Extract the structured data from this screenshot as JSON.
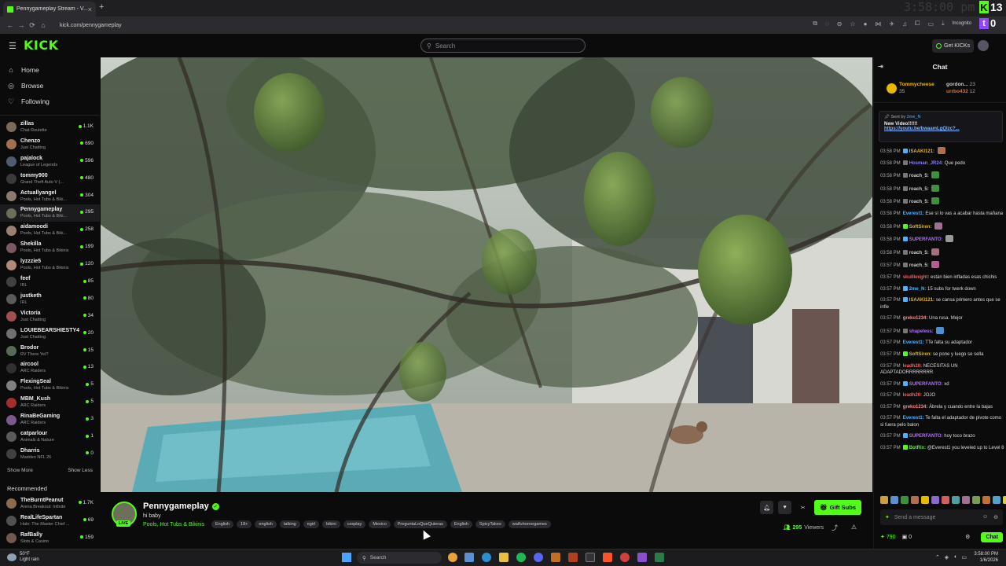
{
  "browser": {
    "tab_title": "Pennygameplay Stream - V...",
    "url": "kick.com/pennygameplay",
    "incognito_label": "Incognito",
    "overlay_time": "3:58:00 pm",
    "kick_viewers_badge": "13",
    "twitch_viewers_badge": "0"
  },
  "header": {
    "search_placeholder": "Search",
    "get_kicks_label": "Get KICKs"
  },
  "sidebar": {
    "nav": [
      {
        "label": "Home",
        "icon": "home-icon"
      },
      {
        "label": "Browse",
        "icon": "compass-icon"
      },
      {
        "label": "Following",
        "icon": "heart-icon"
      }
    ],
    "following": [
      {
        "name": "zillas",
        "category": "Chat Roulette",
        "viewers": "1.1K",
        "color": "#7a6a5a"
      },
      {
        "name": "Chenzo",
        "category": "Just Chatting",
        "viewers": "690",
        "color": "#a07050"
      },
      {
        "name": "pajalock",
        "category": "League of Legends",
        "viewers": "596",
        "color": "#505a70"
      },
      {
        "name": "tommy900",
        "category": "Grand Theft Auto V (...",
        "viewers": "480",
        "color": "#3a3a3a"
      },
      {
        "name": "Actuallyangel",
        "category": "Pools, Hot Tubs & Biki...",
        "viewers": "304",
        "color": "#8a7a70"
      },
      {
        "name": "Pennygameplay",
        "category": "Pools, Hot Tubs & Biki...",
        "viewers": "295",
        "color": "#6c6f5a"
      },
      {
        "name": "aidamoodi",
        "category": "Pools, Hot Tubs & Biki...",
        "viewers": "258",
        "color": "#9a8070"
      },
      {
        "name": "Shekilla",
        "category": "Pools, Hot Tubs & Bikinis",
        "viewers": "199",
        "color": "#7a5a60"
      },
      {
        "name": "lyzzzie5",
        "category": "Pools, Hot Tubs & Bikinis",
        "viewers": "120",
        "color": "#b08a7a"
      },
      {
        "name": "feef",
        "category": "IRL",
        "viewers": "85",
        "color": "#404040"
      },
      {
        "name": "justketh",
        "category": "IRL",
        "viewers": "80",
        "color": "#5a5a5a"
      },
      {
        "name": "Victoria",
        "category": "Just Chatting",
        "viewers": "34",
        "color": "#a05050"
      },
      {
        "name": "LOUIEBEARSHIESTY4",
        "category": "Just Chatting",
        "viewers": "20",
        "color": "#707070"
      },
      {
        "name": "Brodor",
        "category": "RV There Yet?",
        "viewers": "15",
        "color": "#5a6a5a"
      },
      {
        "name": "aircool",
        "category": "ARC Raiders",
        "viewers": "13",
        "color": "#303030"
      },
      {
        "name": "FlexingSeal",
        "category": "Pools, Hot Tubs & Bikinis",
        "viewers": "5",
        "color": "#808080"
      },
      {
        "name": "MBM_Kush",
        "category": "ARC Raiders",
        "viewers": "5",
        "color": "#a03030"
      },
      {
        "name": "RinaBeGaming",
        "category": "ARC Raiders",
        "viewers": "3",
        "color": "#7a5a8a"
      },
      {
        "name": "catparlour",
        "category": "Animals & Nature",
        "viewers": "1",
        "color": "#5a5a5a"
      },
      {
        "name": "Dharris",
        "category": "Madden NFL 26",
        "viewers": "0",
        "color": "#404040"
      }
    ],
    "show_more": "Show More",
    "show_less": "Show Less",
    "recommended_title": "Recommended",
    "recommended": [
      {
        "name": "TheBurntPeanut",
        "category": "Arena Breakout: Infinite",
        "viewers": "1.7K",
        "color": "#8a6a50"
      },
      {
        "name": "RealLifeSpartan",
        "category": "Halo: The Master Chief ...",
        "viewers": "69",
        "color": "#505050"
      },
      {
        "name": "RafBally",
        "category": "Slots & Casino",
        "viewers": "159",
        "color": "#705a50"
      }
    ]
  },
  "stream": {
    "streamer": "Pennygameplay",
    "title": "hi baby",
    "category": "Pools, Hot Tubs & Bikinis",
    "live_label": "LIVE",
    "tags": [
      "English",
      "18+",
      "english",
      "talking",
      "egirl",
      "bikini",
      "cosplay",
      "Mexico",
      "PreguntaLoQueQuieras",
      "English",
      "SpicyTakes",
      "waifuhorrorgames"
    ],
    "gift_subs_label": "Gift Subs",
    "viewers": "295",
    "viewers_label": "Viewers"
  },
  "chat": {
    "title": "Chat",
    "gifters": [
      {
        "name": "Tommycheese",
        "count": "35"
      },
      {
        "name": "gordon...",
        "count": "23"
      },
      {
        "name": "urrbo432",
        "count": "12"
      }
    ],
    "pinned": {
      "sent_by_label": "Sent by",
      "sender": "2me_N",
      "message": "New Video!!!!!!",
      "link": "https://youtu.be/bwaamLgQlzc?..."
    },
    "messages": [
      {
        "time": "03:58 PM",
        "user": "ISAAKI121:",
        "text": "",
        "ucolor": "#e6b800",
        "badge": "#4fb2ff",
        "emote": "#b07050"
      },
      {
        "time": "03:58 PM",
        "user": "Hosman_JR24:",
        "text": "Que pedo",
        "ucolor": "#8a7cff",
        "badge": "#777",
        "emote": ""
      },
      {
        "time": "03:58 PM",
        "user": "roach_5:",
        "text": "",
        "ucolor": "#ccc",
        "badge": "#777",
        "emote": "#3f8f3f"
      },
      {
        "time": "03:58 PM",
        "user": "roach_5:",
        "text": "",
        "ucolor": "#ccc",
        "badge": "#777",
        "emote": "#3f8f3f"
      },
      {
        "time": "03:58 PM",
        "user": "roach_5:",
        "text": "",
        "ucolor": "#ccc",
        "badge": "#777",
        "emote": "#3f8f3f"
      },
      {
        "time": "03:58 PM",
        "user": "Everest1:",
        "text": "Ese sí lo vas a acabar hasta mañana",
        "ucolor": "#4fb2ff",
        "badge": "",
        "emote": ""
      },
      {
        "time": "03:58 PM",
        "user": "SoftSiren:",
        "text": "",
        "ucolor": "#e6b800",
        "badge": "#53fc18",
        "emote": "#a07090"
      },
      {
        "time": "03:58 PM",
        "user": "SUPERFANTO:",
        "text": "",
        "ucolor": "#b070ff",
        "badge": "#4fb2ff",
        "emote": "#999"
      },
      {
        "time": "03:58 PM",
        "user": "roach_5:",
        "text": "",
        "ucolor": "#ccc",
        "badge": "#777",
        "emote": "#a07080"
      },
      {
        "time": "03:57 PM",
        "user": "roach_5:",
        "text": "",
        "ucolor": "#ccc",
        "badge": "#777",
        "emote": "#b06090"
      },
      {
        "time": "03:57 PM",
        "user": "skullknight:",
        "text": "están bien infladas esas chichis",
        "ucolor": "#ff5a5a",
        "badge": "",
        "emote": ""
      },
      {
        "time": "03:57 PM",
        "user": "2me_N:",
        "text": "15 subs for twerk down",
        "ucolor": "#4fb2ff",
        "badge": "#4fb2ff",
        "emote": ""
      },
      {
        "time": "03:57 PM",
        "user": "ISAAKI121:",
        "text": "se cansa primero antes que se infle",
        "ucolor": "#e6b800",
        "badge": "#4fb2ff",
        "emote": ""
      },
      {
        "time": "03:57 PM",
        "user": "greko1234:",
        "text": "Una rusa. Mejor",
        "ucolor": "#ff8a8a",
        "badge": "",
        "emote": ""
      },
      {
        "time": "03:57 PM",
        "user": "shapeless:",
        "text": "",
        "ucolor": "#b070ff",
        "badge": "#777",
        "emote": "#4f8fcf"
      },
      {
        "time": "03:57 PM",
        "user": "Everest1:",
        "text": "TTe falta su adaptador",
        "ucolor": "#4fb2ff",
        "badge": "",
        "emote": ""
      },
      {
        "time": "03:57 PM",
        "user": "SoftSiren:",
        "text": "se pone y luego se sella",
        "ucolor": "#e6b800",
        "badge": "#53fc18",
        "emote": ""
      },
      {
        "time": "03:57 PM",
        "user": "leadh20:",
        "text": "NECESITAS UN ADAPTADORRRRRRRR",
        "ucolor": "#ff5a5a",
        "badge": "",
        "emote": ""
      },
      {
        "time": "03:57 PM",
        "user": "SUPERFANTO:",
        "text": "xd",
        "ucolor": "#b070ff",
        "badge": "#4fb2ff",
        "emote": ""
      },
      {
        "time": "03:57 PM",
        "user": "leadh20:",
        "text": "JOJO",
        "ucolor": "#ff5a5a",
        "badge": "",
        "emote": ""
      },
      {
        "time": "03:57 PM",
        "user": "greko1234:",
        "text": "Ábrela y cuando entre la bajas",
        "ucolor": "#ff8a8a",
        "badge": "",
        "emote": ""
      },
      {
        "time": "03:57 PM",
        "user": "Everest1:",
        "text": "Te falta el adaptador de pivote como si fuera pelo balon",
        "ucolor": "#4fb2ff",
        "badge": "",
        "emote": ""
      },
      {
        "time": "03:57 PM",
        "user": "SUPERFANTO:",
        "text": "hoy toco brazo",
        "ucolor": "#b070ff",
        "badge": "#4fb2ff",
        "emote": ""
      },
      {
        "time": "03:57 PM",
        "user": "BotRix:",
        "text": "@Everest1 you leveled up to Level 8",
        "ucolor": "#53fc18",
        "badge": "#53fc18",
        "emote": ""
      }
    ],
    "input_placeholder": "Send a message",
    "kicks_count": "790",
    "other_count": "0",
    "chat_button": "Chat"
  },
  "taskbar": {
    "temp": "50°F",
    "weather": "Light rain",
    "search_placeholder": "Search",
    "time": "3:58:00 PM",
    "date": "1/6/2026"
  }
}
